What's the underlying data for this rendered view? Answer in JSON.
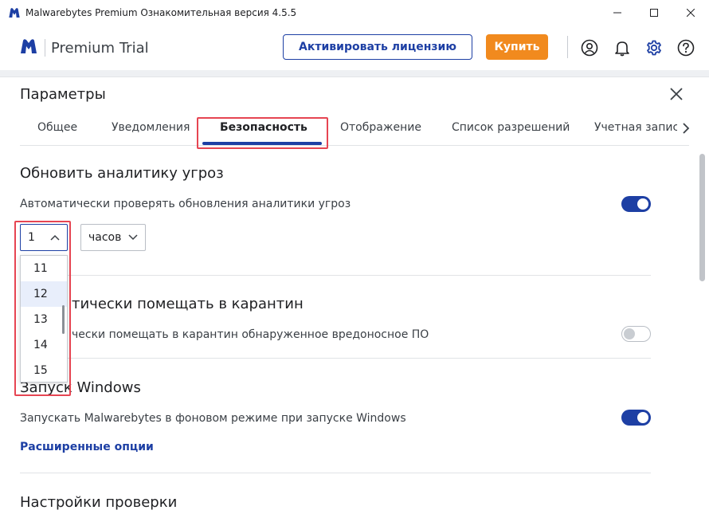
{
  "window": {
    "title": "Malwarebytes Premium Ознакомительная версия  4.5.5",
    "controls": [
      "minimize",
      "maximize",
      "close"
    ]
  },
  "header": {
    "product": "Premium Trial",
    "activate_label": "Активировать лицензию",
    "buy_label": "Купить",
    "icons": [
      "account-icon",
      "bell-icon",
      "gear-icon",
      "help-icon"
    ],
    "colors": {
      "brand_blue": "#1d3fa4",
      "buy_orange": "#f18a1e",
      "highlight_red": "#e64552"
    }
  },
  "settings": {
    "title": "Параметры",
    "tabs": [
      {
        "label": "Общее"
      },
      {
        "label": "Уведомления"
      },
      {
        "label": "Безопасность",
        "active": true
      },
      {
        "label": "Отображение"
      },
      {
        "label": "Список разрешений"
      },
      {
        "label": "Учетная запис"
      }
    ],
    "sections": {
      "threat_intel": {
        "title": "Обновить аналитику угроз",
        "auto_check_label": "Автоматически проверять обновления аналитики угроз",
        "auto_check_enabled": true,
        "interval_value": "1",
        "interval_unit": "часов",
        "dropdown_options": [
          "11",
          "12",
          "13",
          "14",
          "15"
        ],
        "dropdown_highlighted": "12"
      },
      "quarantine": {
        "title": "Автоматически помещать в карантин",
        "title_visible": "тически помещать в карантин",
        "label": "Автоматически помещать в карантин обнаруженное вредоносное ПО",
        "label_visible": "чески помещать в карантин обнаруженное вредоносное ПО",
        "enabled": false
      },
      "windows_startup": {
        "title": "Запуск Windows",
        "label": "Запускать Malwarebytes в фоновом режиме при запуске Windows",
        "enabled": true,
        "advanced_link": "Расширенные опции"
      },
      "scan_settings": {
        "title": "Настройки проверки"
      }
    }
  }
}
